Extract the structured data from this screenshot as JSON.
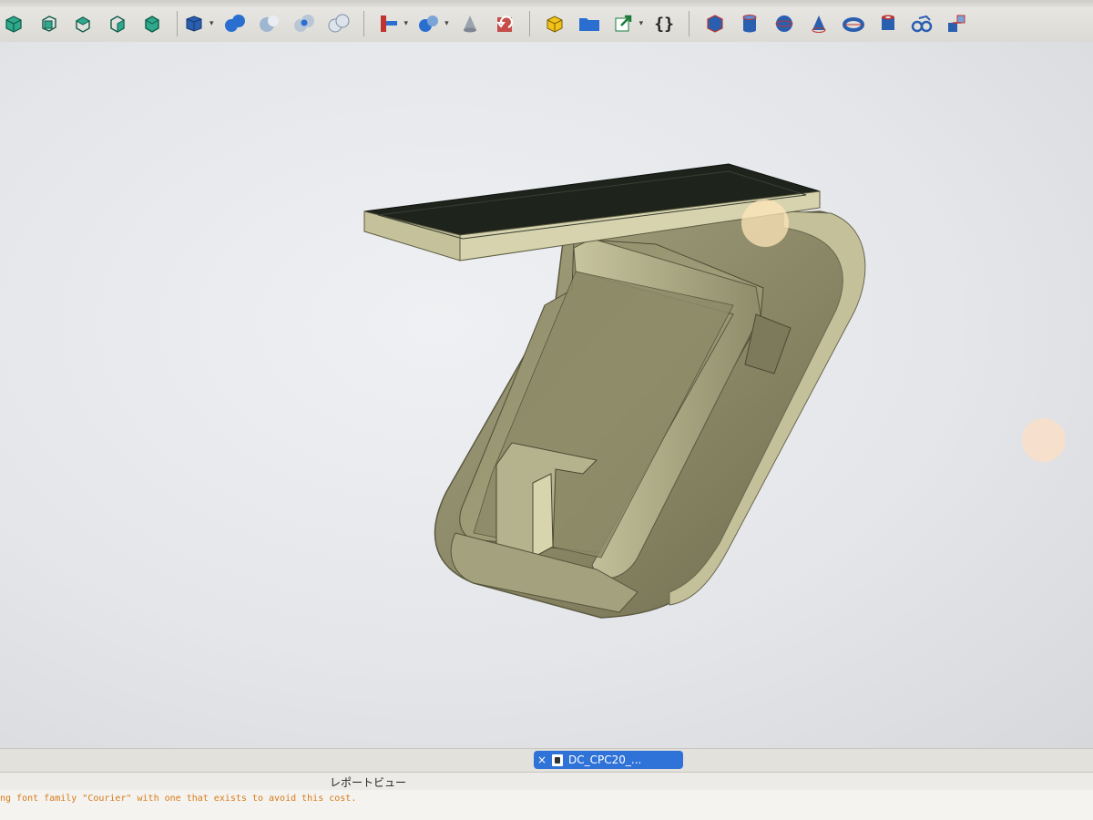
{
  "toolbar": {
    "buttons": [
      {
        "name": "view-iso",
        "icon": "cube-iso-icon"
      },
      {
        "name": "view-front",
        "icon": "cube-front-icon"
      },
      {
        "name": "view-top",
        "icon": "cube-top-icon"
      },
      {
        "name": "view-right",
        "icon": "cube-right-icon"
      },
      {
        "name": "view-rear",
        "icon": "cube-rear-icon"
      },
      {
        "name": "draw-style",
        "icon": "box-icon"
      },
      {
        "name": "part-union",
        "icon": "spheres-union-icon"
      },
      {
        "name": "part-cut",
        "icon": "sphere-cut-icon"
      },
      {
        "name": "part-common",
        "icon": "spheres-common-icon"
      },
      {
        "name": "part-fragments",
        "icon": "spheres-outline-icon"
      },
      {
        "name": "measure",
        "icon": "measure-icon"
      },
      {
        "name": "booleans",
        "icon": "spheres-boolean-icon"
      },
      {
        "name": "revolve",
        "icon": "cone-icon"
      },
      {
        "name": "undo",
        "icon": "undo-icon"
      },
      {
        "name": "part-body",
        "icon": "yellow-part-icon"
      },
      {
        "name": "folder",
        "icon": "folder-icon"
      },
      {
        "name": "export",
        "icon": "export-icon"
      },
      {
        "name": "macro",
        "icon": "braces-icon"
      },
      {
        "name": "primitive-box",
        "icon": "blue-box-icon"
      },
      {
        "name": "primitive-cylinder",
        "icon": "cylinder-icon"
      },
      {
        "name": "primitive-sphere",
        "icon": "sphere-icon"
      },
      {
        "name": "primitive-cone",
        "icon": "cone-red-icon"
      },
      {
        "name": "primitive-torus",
        "icon": "torus-icon"
      },
      {
        "name": "primitive-tube",
        "icon": "tube-icon"
      },
      {
        "name": "shape-builder",
        "icon": "shape-builder-icon"
      },
      {
        "name": "primitives-dialog",
        "icon": "primitives-icon"
      }
    ],
    "macro_label": "{}"
  },
  "tabs": {
    "active_doc": "DC_CPC20_...",
    "close_glyph": "×"
  },
  "report": {
    "title": "レポートビュー",
    "line": "ng font family \"Courier\" with one that exists to avoid this cost."
  },
  "colors": {
    "model_face": "#b7b48c",
    "model_dark": "#6f6c4e",
    "model_top": "#1f241d",
    "tab_blue": "#2f73d8",
    "report_text": "#d87a1a"
  }
}
